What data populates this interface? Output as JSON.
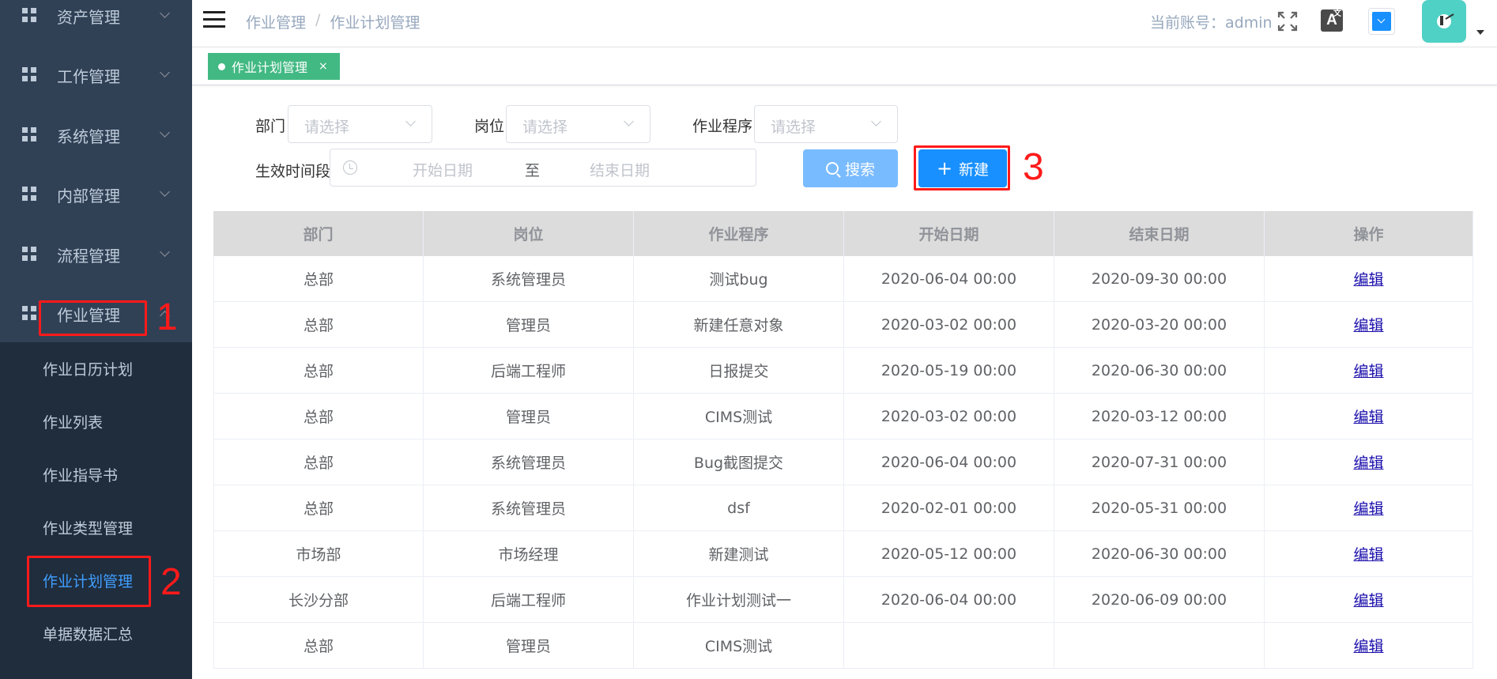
{
  "sidebar": {
    "menu": [
      {
        "label": "资产管理",
        "icon": "grid-icon"
      },
      {
        "label": "工作管理",
        "icon": "grid-icon"
      },
      {
        "label": "系统管理",
        "icon": "grid-icon"
      },
      {
        "label": "内部管理",
        "icon": "grid-icon"
      },
      {
        "label": "流程管理",
        "icon": "grid-icon"
      },
      {
        "label": "作业管理",
        "icon": "grid-icon",
        "expanded": true
      }
    ],
    "submenu": [
      {
        "label": "作业日历计划"
      },
      {
        "label": "作业列表"
      },
      {
        "label": "作业指导书"
      },
      {
        "label": "作业类型管理"
      },
      {
        "label": "作业计划管理",
        "active": true
      },
      {
        "label": "单据数据汇总"
      }
    ]
  },
  "header": {
    "breadcrumb": [
      "作业管理",
      "作业计划管理"
    ],
    "breadcrumb_separator": "/",
    "account": "当前账号：admin",
    "icons": [
      "menu-icon",
      "fullscreen-icon",
      "translate-icon",
      "theme-picker-icon",
      "avatar",
      "caret-down-icon"
    ],
    "translate_glyph": "A",
    "translate_sup": "文"
  },
  "tags": {
    "active": {
      "label": "作业计划管理",
      "close": "×"
    }
  },
  "filters": {
    "department": {
      "label": "部门",
      "placeholder": "请选择"
    },
    "position": {
      "label": "岗位",
      "placeholder": "请选择"
    },
    "procedure": {
      "label": "作业程序",
      "placeholder": "请选择"
    },
    "period": {
      "label": "生效时间段",
      "start_placeholder": "开始日期",
      "separator": "至",
      "end_placeholder": "结束日期"
    },
    "search_label": "搜索",
    "new_label": "新建"
  },
  "annotations": [
    "1",
    "2",
    "3"
  ],
  "table": {
    "headers": [
      "部门",
      "岗位",
      "作业程序",
      "开始日期",
      "结束日期",
      "操作"
    ],
    "rows": [
      [
        "总部",
        "系统管理员",
        "测试bug",
        "2020-06-04 00:00",
        "2020-09-30 00:00",
        "编辑"
      ],
      [
        "总部",
        "管理员",
        "新建任意对象",
        "2020-03-02 00:00",
        "2020-03-20 00:00",
        "编辑"
      ],
      [
        "总部",
        "后端工程师",
        "日报提交",
        "2020-05-19 00:00",
        "2020-06-30 00:00",
        "编辑"
      ],
      [
        "总部",
        "管理员",
        "CIMS测试",
        "2020-03-02 00:00",
        "2020-03-12 00:00",
        "编辑"
      ],
      [
        "总部",
        "系统管理员",
        "Bug截图提交",
        "2020-06-04 00:00",
        "2020-07-31 00:00",
        "编辑"
      ],
      [
        "总部",
        "系统管理员",
        "dsf",
        "2020-02-01 00:00",
        "2020-05-31 00:00",
        "编辑"
      ],
      [
        "市场部",
        "市场经理",
        "新建测试",
        "2020-05-12 00:00",
        "2020-06-30 00:00",
        "编辑"
      ],
      [
        "长沙分部",
        "后端工程师",
        "作业计划测试一",
        "2020-06-04 00:00",
        "2020-06-09 00:00",
        "编辑"
      ],
      [
        "总部",
        "管理员",
        "CIMS测试",
        "",
        "",
        "编辑"
      ]
    ]
  },
  "colors": {
    "sidebar_bg": "#304156",
    "submenu_bg": "#1f2d3d",
    "active_link": "#409eff",
    "tag_green": "#42b983",
    "primary": "#1890ff",
    "annotation_red": "#ff1a1a"
  }
}
